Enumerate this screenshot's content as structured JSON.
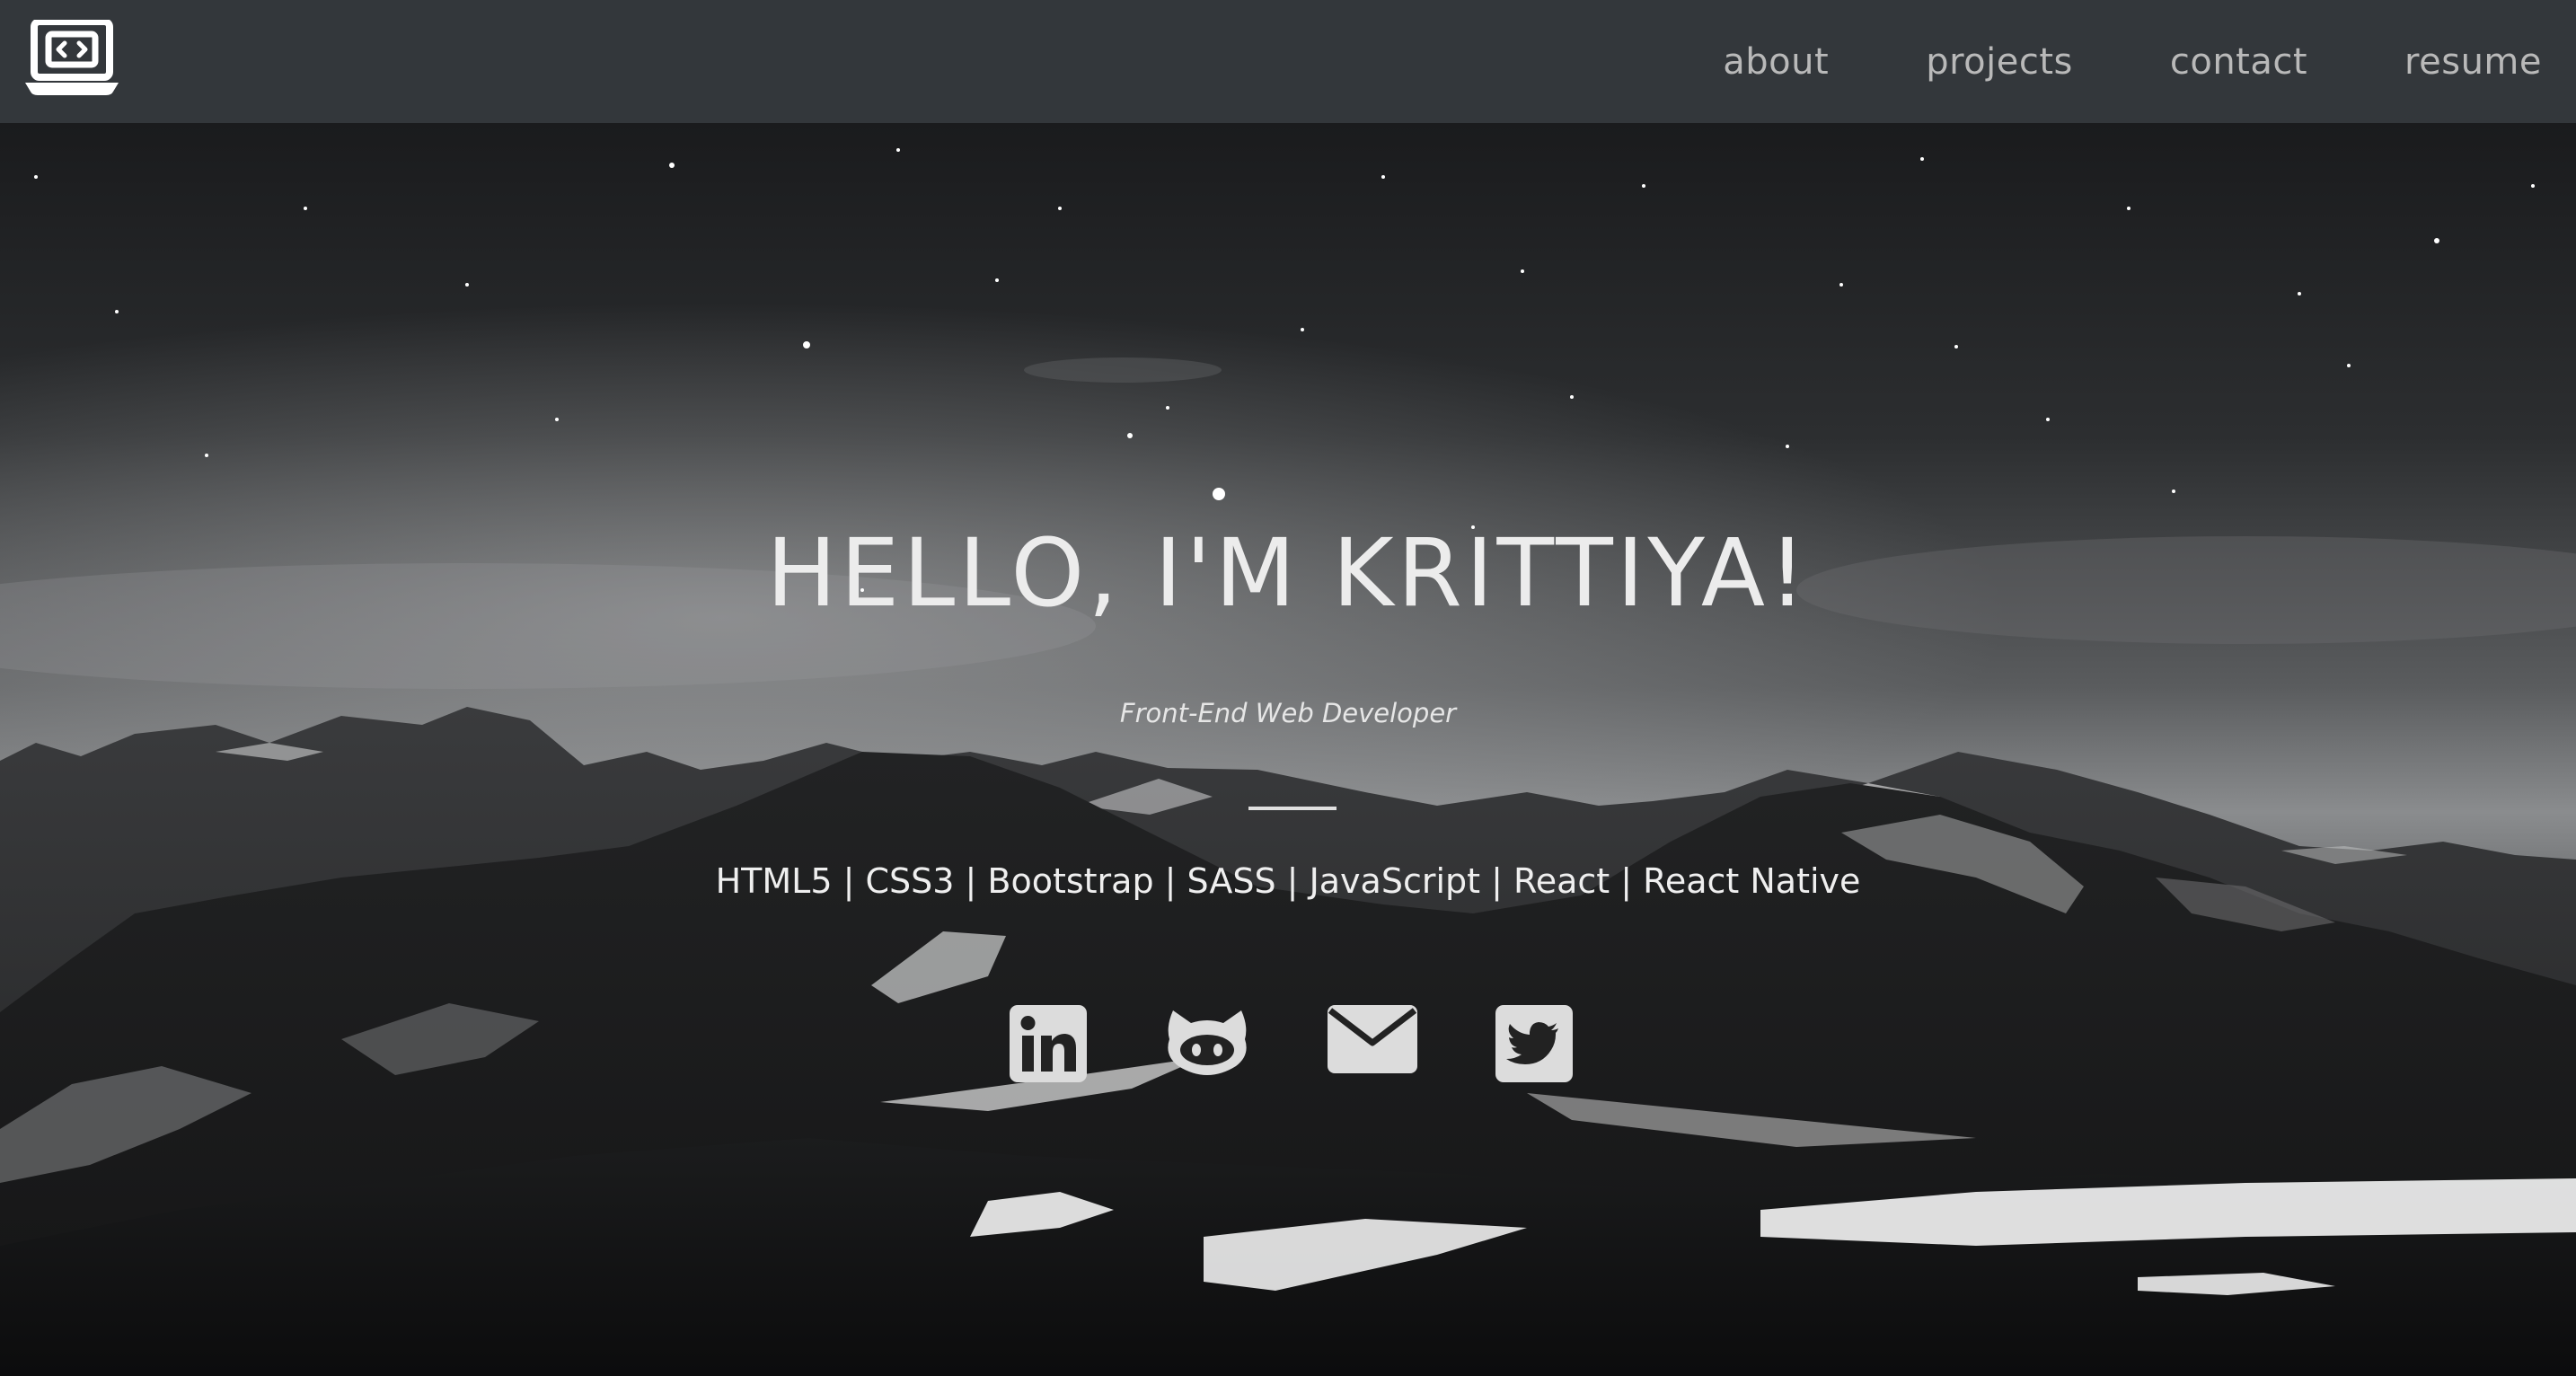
{
  "navbar": {
    "logo_icon": "laptop-code-icon",
    "links": [
      {
        "label": "about"
      },
      {
        "label": "projects"
      },
      {
        "label": "contact"
      },
      {
        "label": "resume"
      }
    ]
  },
  "hero": {
    "title": "HELLO, I'M KRITTIYA!",
    "subtitle": "Front-End Web Developer",
    "skills": "HTML5 | CSS3 | Bootstrap | SASS | JavaScript | React | React Native",
    "background": "night-sky-mountains-grayscale",
    "social": [
      {
        "icon": "linkedin-icon"
      },
      {
        "icon": "github-icon"
      },
      {
        "icon": "email-icon"
      },
      {
        "icon": "twitter-icon"
      }
    ]
  },
  "colors": {
    "navbar_bg": "#33373b",
    "nav_text": "#b9b9b9",
    "hero_text": "#ececec",
    "icon_fill": "#dcdcdc"
  }
}
